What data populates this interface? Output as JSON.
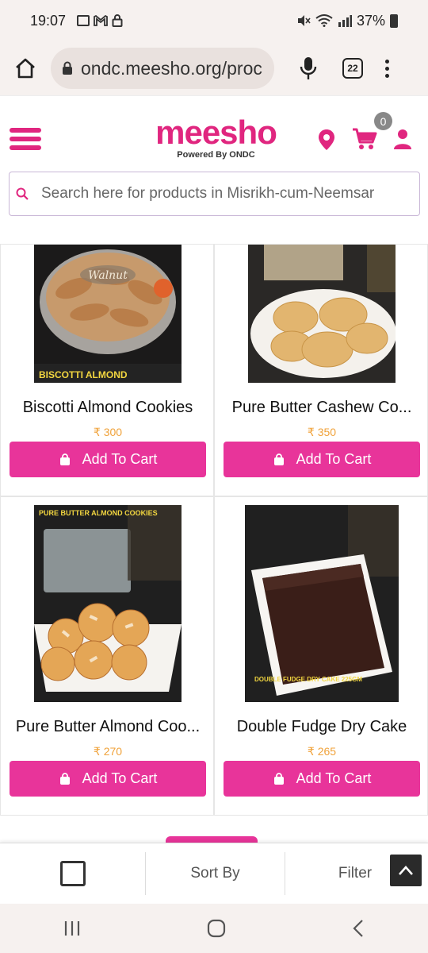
{
  "status_bar": {
    "time": "19:07",
    "battery": "37%",
    "icons_left": [
      "image-icon",
      "gmail-icon",
      "lock-icon"
    ],
    "icons_right": [
      "mute-icon",
      "wifi-icon",
      "signal-icon",
      "battery-icon"
    ]
  },
  "browser": {
    "url": "ondc.meesho.org/proc",
    "tab_count": "22"
  },
  "header": {
    "brand": "meesho",
    "tagline": "Powered By ONDC",
    "cart_count": "0"
  },
  "search": {
    "placeholder": "Search here for products in Misrikh-cum-Neemsar"
  },
  "products": [
    {
      "name": "Biscotti Almond Cookies",
      "price": "₹ 300",
      "button": "Add To Cart",
      "image_label": "BISCOTTI ALMOND"
    },
    {
      "name": "Pure Butter Cashew Co...",
      "price": "₹ 350",
      "button": "Add To Cart",
      "image_label": ""
    },
    {
      "name": "Pure Butter Almond Coo...",
      "price": "₹ 270",
      "button": "Add To Cart",
      "image_label": "PURE BUTTER ALMOND COOKIES"
    },
    {
      "name": "Double Fudge Dry Cake",
      "price": "₹ 265",
      "button": "Add To Cart",
      "image_label": "DOUBLE FUDGE DRY CAKE 225GM"
    }
  ],
  "toolbar": {
    "sort_label": "Sort By",
    "filter_label": "Filter"
  },
  "colors": {
    "brand": "#e0267f",
    "button": "#e8349a",
    "price": "#f0a23a"
  }
}
